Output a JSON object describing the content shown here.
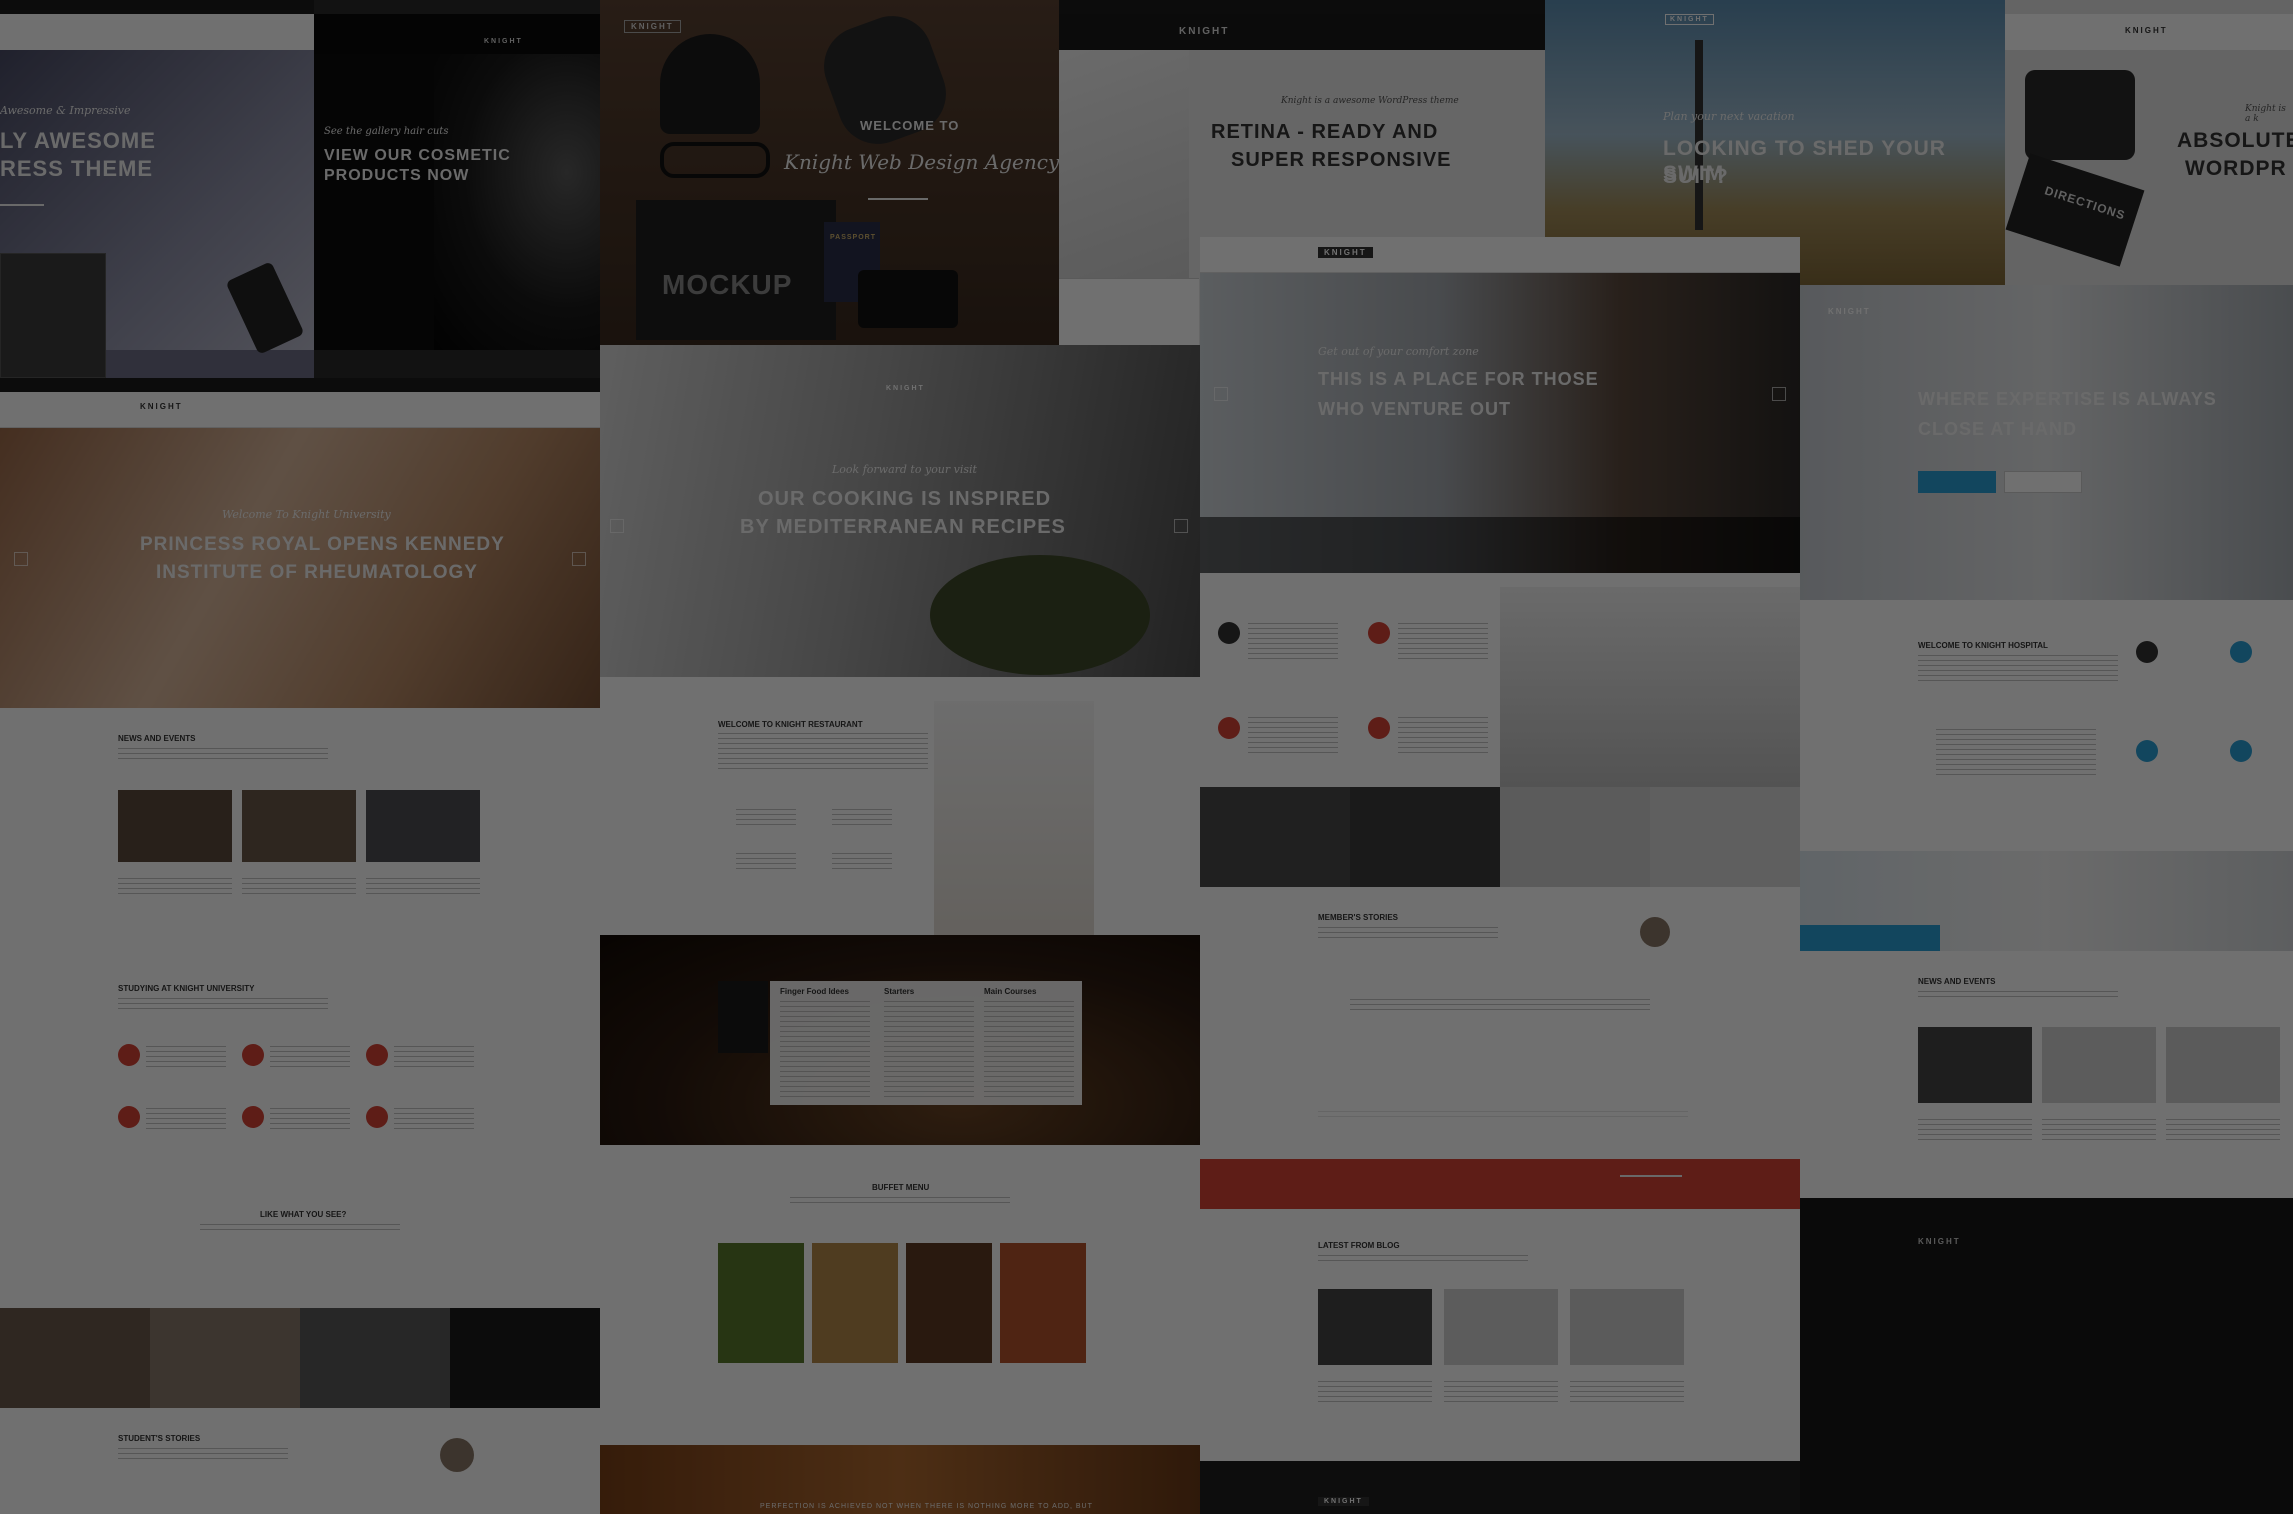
{
  "brand": "KNIGHT",
  "tiles": {
    "t1": {
      "hero_sub": "Awesome & Impressive",
      "hero_title_1": "LY AWESOME",
      "hero_title_2": "RESS THEME"
    },
    "t2": {
      "hero_sub": "See the gallery hair cuts",
      "hero_title_1": "VIEW OUR COSMETIC",
      "hero_title_2": "PRODUCTS NOW"
    },
    "t3": {
      "welcome": "WELCOME TO",
      "agency": "Knight Web Design Agency",
      "mockup": "MOCKUP",
      "passport": "PASSPORT"
    },
    "t4": {
      "hero_sub": "Knight is a awesome WordPress theme",
      "hero_title_1": "RETINA - READY AND",
      "hero_title_2": "SUPER RESPONSIVE"
    },
    "t5": {
      "hero_sub": "Plan your next vacation",
      "hero_title_1": "LOOKING TO SHED YOUR SWIM",
      "hero_title_2": "SUIT?",
      "sign": "DIRECTIONS"
    },
    "t6": {
      "hero_sub": "Knight is a k",
      "hero_title_1": "ABSOLUTE",
      "hero_title_2": "WORDPR"
    },
    "university": {
      "hero_sub": "Welcome To Knight University",
      "hero_title_1": "PRINCESS ROYAL OPENS KENNEDY",
      "hero_title_2": "INSTITUTE OF RHEUMATOLOGY",
      "news_heading": "NEWS AND EVENTS",
      "studying_heading": "STUDYING AT KNIGHT UNIVERSITY",
      "like_heading": "LIKE WHAT YOU SEE?",
      "stories_heading": "STUDENT'S STORIES"
    },
    "restaurant": {
      "hero_sub": "Look forward to your visit",
      "hero_title_1": "OUR COOKING IS INSPIRED",
      "hero_title_2": "BY MEDITERRANEAN RECIPES",
      "welcome_heading": "WELCOME TO KNIGHT RESTAURANT",
      "menu_col_1": "Finger Food Idees",
      "menu_col_2": "Starters",
      "menu_col_3": "Main Courses",
      "buffet_heading": "BUFFET MENU",
      "footer_quote": "PERFECTION IS ACHIEVED NOT WHEN THERE IS NOTHING MORE TO ADD, BUT"
    },
    "fitness": {
      "hero_sub": "Get out of your comfort zone",
      "hero_title_1": "THIS IS A PLACE FOR THOSE",
      "hero_title_2": "WHO VENTURE OUT",
      "members_heading": "MEMBER'S STORIES",
      "blog_heading": "LATEST FROM BLOG"
    },
    "hospital": {
      "hero_title_1": "WHERE EXPERTISE IS ALWAYS",
      "hero_title_2": "CLOSE AT HAND",
      "welcome_heading": "WELCOME TO KNIGHT HOSPITAL",
      "news_heading": "NEWS AND EVENTS"
    }
  },
  "colors": {
    "accent_red": "#d64236",
    "accent_blue": "#2a9fd6",
    "dim_overlay": "rgba(0,0,0,0.56)"
  }
}
